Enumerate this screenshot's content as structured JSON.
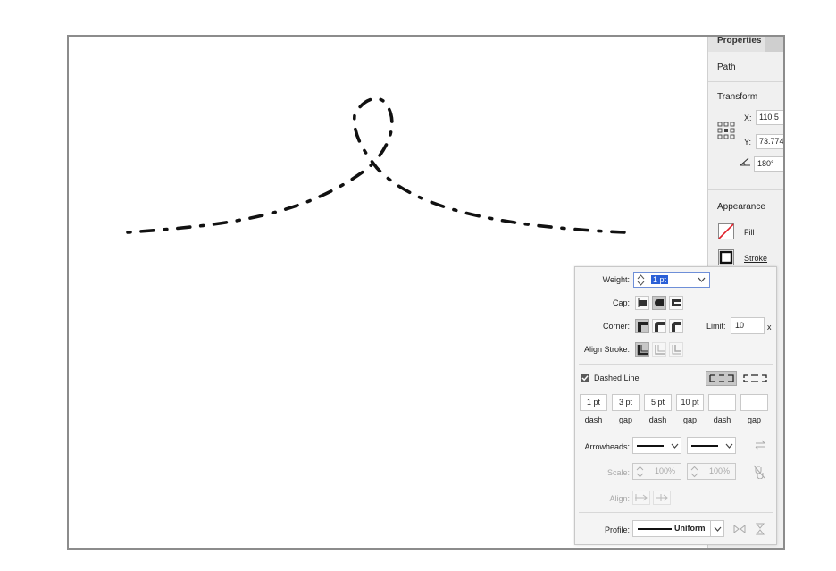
{
  "properties": {
    "tab_label": "Properties",
    "object_type": "Path",
    "transform": {
      "section_label": "Transform",
      "x_label": "X:",
      "x_value": "110.5",
      "y_label": "Y:",
      "y_value": "73.774",
      "angle_value": "180°"
    },
    "appearance": {
      "section_label": "Appearance",
      "fill_label": "Fill",
      "stroke_label": "Stroke"
    }
  },
  "stroke_panel": {
    "weight_label": "Weight:",
    "weight_value": "1 pt",
    "cap_label": "Cap:",
    "corner_label": "Corner:",
    "limit_label": "Limit:",
    "limit_value": "10",
    "limit_unit": "x",
    "align_stroke_label": "Align Stroke:",
    "dashed_line_label": "Dashed Line",
    "dashed_line_checked": true,
    "dash_fields": [
      {
        "value": "1 pt",
        "label": "dash"
      },
      {
        "value": "3 pt",
        "label": "gap"
      },
      {
        "value": "5 pt",
        "label": "dash"
      },
      {
        "value": "10 pt",
        "label": "gap"
      },
      {
        "value": "",
        "label": "dash"
      },
      {
        "value": "",
        "label": "gap"
      }
    ],
    "arrowheads_label": "Arrowheads:",
    "scale_label": "Scale:",
    "scale_start": "100%",
    "scale_end": "100%",
    "align_label": "Align:",
    "profile_label": "Profile:",
    "profile_value": "Uniform"
  },
  "colors": {
    "selection": "#2a5fd7",
    "fill_none": "#e0202a",
    "stroke": "#111111"
  }
}
